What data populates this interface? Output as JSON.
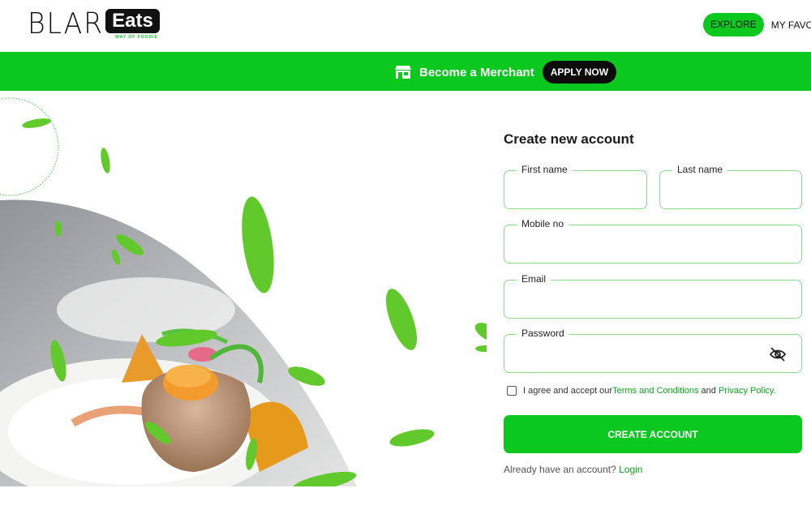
{
  "brand": {
    "logo_left": "BLAR",
    "logo_right": "Eats",
    "tagline": "WAY OF FOODIE"
  },
  "nav": {
    "explore_label": "EXPLORE",
    "favourites_label": "MY FAVOU"
  },
  "banner": {
    "text": "Become a Merchant",
    "apply_label": "APPLY NOW",
    "icon": "store-icon"
  },
  "form": {
    "title": "Create new account",
    "fields": {
      "first_name": {
        "label": "First name",
        "value": ""
      },
      "last_name": {
        "label": "Last name",
        "value": ""
      },
      "mobile": {
        "label": "Mobile no",
        "value": ""
      },
      "email": {
        "label": "Email",
        "value": ""
      },
      "password": {
        "label": "Password",
        "value": "",
        "icon": "eye-slash-icon"
      }
    },
    "agree": {
      "prefix": "I agree and accept our ",
      "terms": "Terms and Conditions",
      "middle": " and ",
      "privacy": "Privacy Policy.",
      "checked": false
    },
    "submit_label": "CREATE ACCOUNT",
    "login_prompt": "Already have an account? ",
    "login_link": "Login"
  },
  "colors": {
    "accent": "#0ac81e",
    "dark": "#0c0c0c",
    "field_border": "#8fd68f"
  }
}
